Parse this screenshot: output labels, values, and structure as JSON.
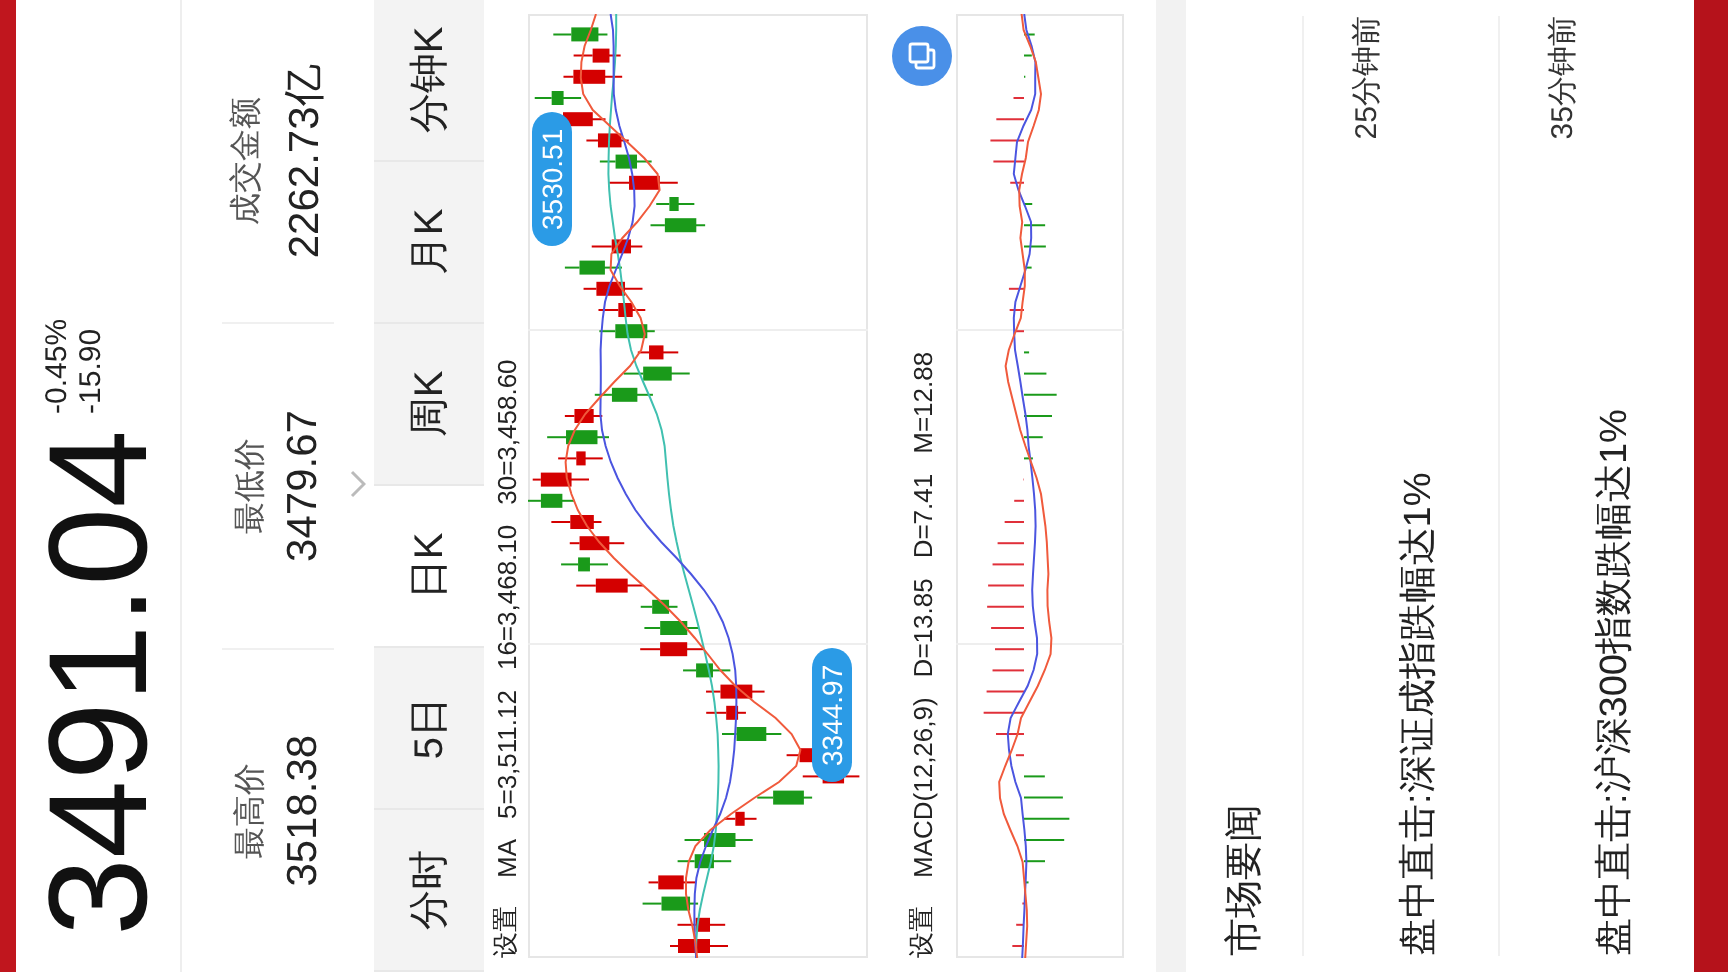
{
  "quote": {
    "price": "3491.04",
    "change_pct": "-0.45%",
    "change": "-15.90"
  },
  "stats": [
    {
      "label": "最高价",
      "value": "3518.38"
    },
    {
      "label": "最低价",
      "value": "3479.67"
    },
    {
      "label": "成交金额",
      "value": "2262.73亿"
    }
  ],
  "tabs": [
    {
      "label": "分时",
      "selected": false
    },
    {
      "label": "5日",
      "selected": false
    },
    {
      "label": "日K",
      "selected": true
    },
    {
      "label": "周K",
      "selected": false
    },
    {
      "label": "月K",
      "selected": false
    },
    {
      "label": "分钟K",
      "selected": false
    }
  ],
  "kline": {
    "settings": "设置",
    "indicator": "MA",
    "values": [
      "5=3,511.12",
      "16=3,468.10",
      "30=3,458.60"
    ],
    "max_label": "3530.51",
    "min_label": "3344.97"
  },
  "macd": {
    "settings": "设置",
    "indicator": "MACD(12,26,9)",
    "values": [
      "D=13.85",
      "D=7.41",
      "M=12.88"
    ]
  },
  "news": {
    "title": "市场要闻",
    "items": [
      {
        "title": "盘中直击:深证成指跌幅达1%",
        "time": "25分钟前"
      },
      {
        "title": "盘中直击:沪深300指数跌幅达1%",
        "time": "35分钟前"
      }
    ]
  }
}
